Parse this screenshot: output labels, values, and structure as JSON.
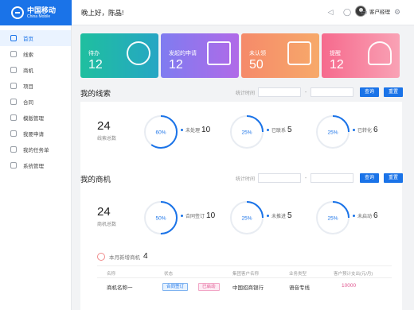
{
  "brand": {
    "name_cn": "中国移动",
    "name_en": "China Mobile"
  },
  "header": {
    "greeting": "晚上好，陈晶!",
    "user_name": "客户经理",
    "icons": [
      "volume-icon",
      "chat-icon",
      "document-icon",
      "heart-icon",
      "settings-icon"
    ]
  },
  "sidebar": {
    "items": [
      {
        "label": "首页",
        "icon": "home-icon",
        "active": true
      },
      {
        "label": "线索",
        "icon": "clue-icon"
      },
      {
        "label": "商机",
        "icon": "opportunity-icon"
      },
      {
        "label": "项目",
        "icon": "project-icon"
      },
      {
        "label": "合同",
        "icon": "contract-icon"
      },
      {
        "label": "模版管理",
        "icon": "template-icon"
      },
      {
        "label": "我要申请",
        "icon": "apply-icon"
      },
      {
        "label": "我的任务单",
        "icon": "task-icon"
      },
      {
        "label": "系统管理",
        "icon": "gear-icon"
      }
    ]
  },
  "cards": [
    {
      "label": "待办",
      "value": "12",
      "icon": "clock-icon",
      "color": "#22b3b5"
    },
    {
      "label": "发起的申请",
      "value": "12",
      "icon": "form-icon",
      "color": "#9873ec"
    },
    {
      "label": "未认领",
      "value": "50",
      "icon": "inbox-icon",
      "color": "#f6996a"
    },
    {
      "label": "提醒",
      "value": "12",
      "icon": "bell-icon",
      "color": "#f7819f"
    }
  ],
  "filter": {
    "label": "统计时间",
    "dash": "-",
    "query": "查询",
    "reset": "重置"
  },
  "clues": {
    "title": "我的线索",
    "total_value": "24",
    "total_label": "线索总数",
    "rings": [
      {
        "percent": 60,
        "percent_label": "60%",
        "legend": "未处理",
        "value": "10"
      },
      {
        "percent": 25,
        "percent_label": "25%",
        "legend": "已联系",
        "value": "5"
      },
      {
        "percent": 25,
        "percent_label": "25%",
        "legend": "已转化",
        "value": "6"
      }
    ]
  },
  "opps": {
    "title": "我的商机",
    "total_value": "24",
    "total_label": "商机总数",
    "rings": [
      {
        "percent": 50,
        "percent_label": "50%",
        "legend": "合同签订",
        "value": "10"
      },
      {
        "percent": 25,
        "percent_label": "25%",
        "legend": "未推进",
        "value": "5"
      },
      {
        "percent": 25,
        "percent_label": "25%",
        "legend": "未启动",
        "value": "6"
      }
    ],
    "new_label": "本月新增商机",
    "new_value": "4",
    "columns": [
      "名称",
      "状态",
      "集团客户名称",
      "业务类型",
      "客户预计支出(元/月)"
    ],
    "rows": [
      {
        "name": "商机名称一",
        "status1": "合同签订",
        "status2": "已启动",
        "customer": "中国招商银行",
        "biz": "语音专线",
        "amount": "10000"
      }
    ]
  },
  "colors": {
    "accent": "#1a73e8",
    "amount": "#e0558f"
  }
}
